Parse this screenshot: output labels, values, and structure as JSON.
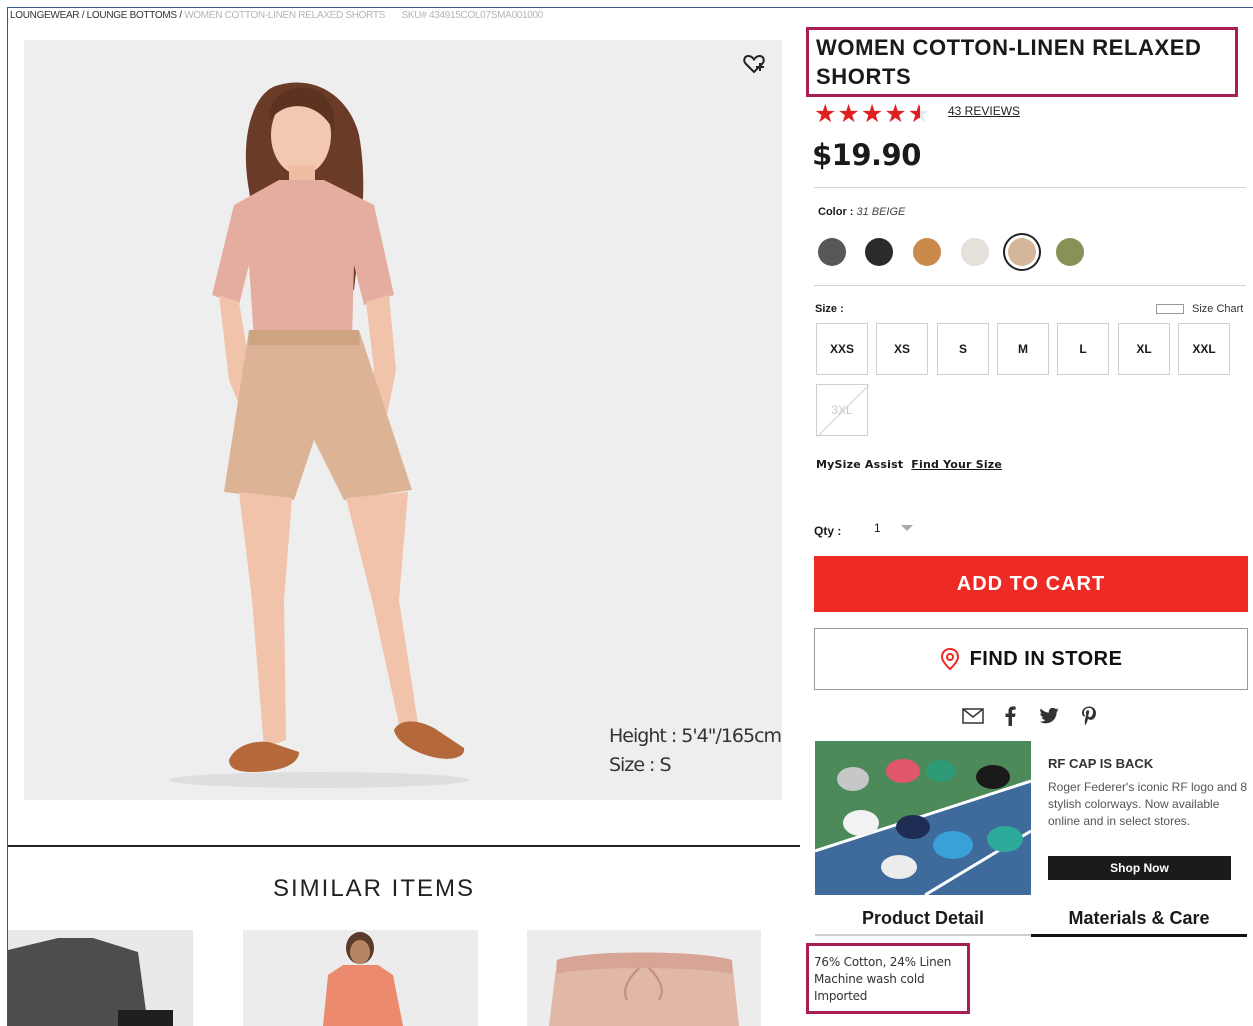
{
  "breadcrumb": {
    "path": "LOUNGEWEAR / LOUNGE BOTTOMS /",
    "current": "WOMEN COTTON-LINEN RELAXED SHORTS",
    "sku": "SKU# 434915COL07SMA001000"
  },
  "product_image": {
    "model_height": "Height : 5'4\"/165cm",
    "model_size": "Size : S"
  },
  "similar": {
    "title": "SIMILAR ITEMS"
  },
  "product": {
    "title": "WOMEN COTTON-LINEN RELAXED SHORTS",
    "rating": 4.5,
    "reviews": "43 REVIEWS",
    "price": "$19.90"
  },
  "color": {
    "label": "Color :",
    "value": "31 BEIGE",
    "swatches": [
      {
        "name": "dark-gray",
        "hex": "#575759"
      },
      {
        "name": "black",
        "hex": "#2b2b2d"
      },
      {
        "name": "orange",
        "hex": "#c98a4c"
      },
      {
        "name": "off-white",
        "hex": "#e7e1dc"
      },
      {
        "name": "beige",
        "hex": "#d4b69a",
        "selected": true
      },
      {
        "name": "olive",
        "hex": "#8a9157"
      }
    ]
  },
  "size": {
    "label": "Size :",
    "chart_label": "Size Chart",
    "options": [
      "XXS",
      "XS",
      "S",
      "M",
      "L",
      "XL",
      "XXL",
      "3XL"
    ],
    "unavailable": [
      "3XL"
    ]
  },
  "mysize": {
    "label": "MySize Assist",
    "link": "Find Your Size"
  },
  "quantity": {
    "label": "Qty :",
    "value": "1"
  },
  "actions": {
    "add_to_cart": "ADD TO CART",
    "find_in_store": "FIND IN STORE"
  },
  "promo": {
    "title": "RF CAP IS BACK",
    "text": "Roger Federer's iconic RF logo and 8 stylish colorways. Now available online and in select stores.",
    "button": "Shop Now"
  },
  "tabs": {
    "product_detail": "Product Detail",
    "materials_care": "Materials & Care"
  },
  "materials": {
    "lines": [
      "76% Cotton, 24% Linen",
      "Machine wash cold",
      "Imported"
    ]
  },
  "colors": {
    "accent_red": "#ee2a24",
    "highlight": "#a51f55",
    "star": "#e02020"
  }
}
